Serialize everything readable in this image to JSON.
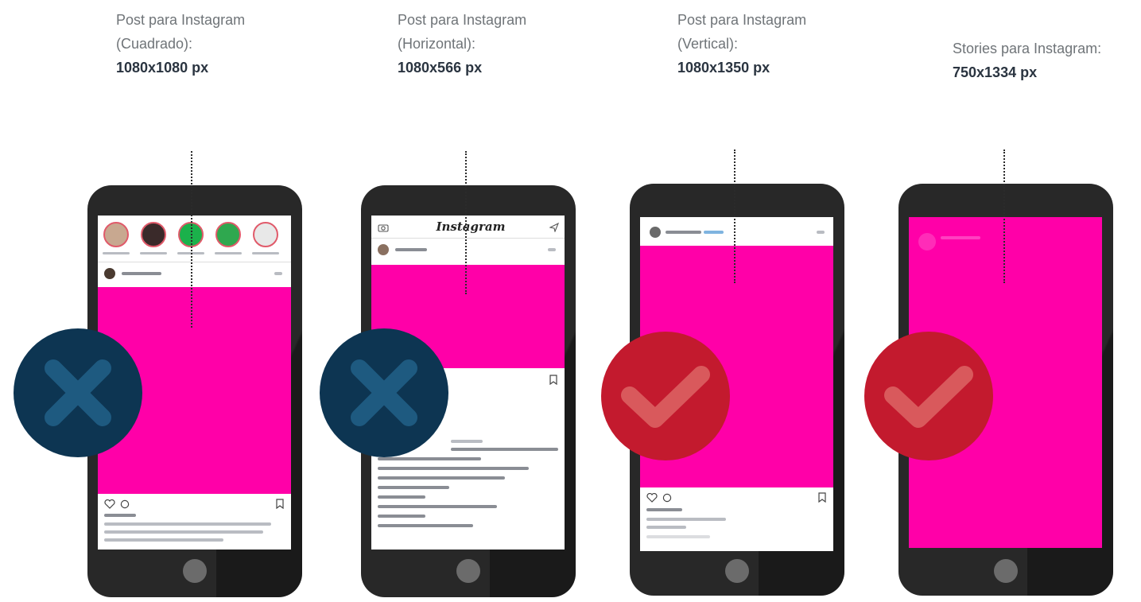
{
  "formats": [
    {
      "label_line1": "Post para Instagram",
      "label_line2": "(Cuadrado):",
      "size": "1080x1080 px",
      "valid": false,
      "status_icon": "cross-icon"
    },
    {
      "label_line1": "Post para Instagram",
      "label_line2": "(Horizontal):",
      "size": "1080x566 px",
      "valid": false,
      "status_icon": "cross-icon"
    },
    {
      "label_line1": "Post para Instagram",
      "label_line2": "(Vertical):",
      "size": "1080x1350 px",
      "valid": true,
      "status_icon": "check-icon"
    },
    {
      "label_line1": "Stories para Instagram:",
      "size": "750x1334 px",
      "valid": true,
      "status_icon": "check-icon"
    }
  ],
  "app_name": "Instagram",
  "colors": {
    "placeholder": "#ff00a8",
    "invalid_badge": "#0d3552",
    "valid_badge": "#c31a2e",
    "phone_body": "#282828"
  }
}
